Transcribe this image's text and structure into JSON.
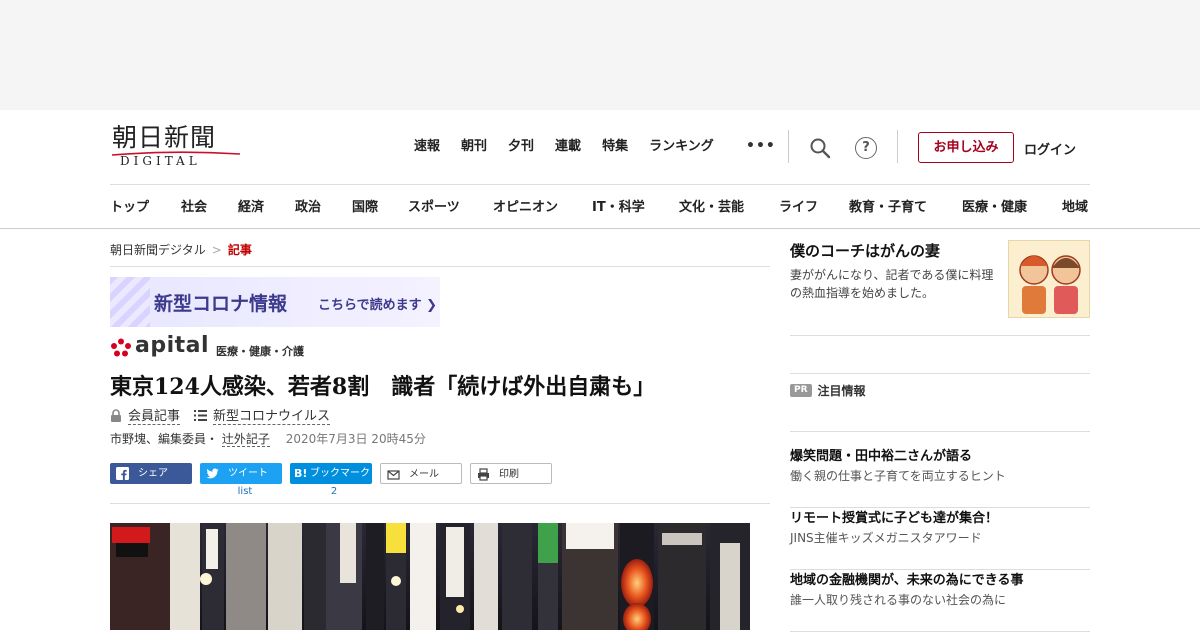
{
  "header": {
    "logo_main": "朝日新聞",
    "logo_sub": "DIGITAL",
    "top_nav": [
      "速報",
      "朝刊",
      "夕刊",
      "連載",
      "特集",
      "ランキング"
    ],
    "more": "•••",
    "help": "?",
    "apply_label": "お申し込み",
    "login_label": "ログイン",
    "categories": [
      "トップ",
      "社会",
      "経済",
      "政治",
      "国際",
      "スポーツ",
      "オピニオン",
      "IT・科学",
      "文化・芸能",
      "ライフ",
      "教育・子育て",
      "医療・健康",
      "地域"
    ]
  },
  "breadcrumb": {
    "home": "朝日新聞デジタル",
    "sep": ">",
    "current": "記事"
  },
  "banner": {
    "title": "新型コロナ情報",
    "link": "こちらで読めます ❯"
  },
  "apital": {
    "word": "apital",
    "category": "医療・健康・介護"
  },
  "article": {
    "headline": "東京124人感染、若者8割　識者「続けば外出自粛も」",
    "tag_member": "会員記事",
    "tag_topic": "新型コロナウイルス",
    "byline_prefix": "市野塊、編集委員・",
    "byline_author": "辻外記子",
    "date": "2020年7月3日 20時45分"
  },
  "share": {
    "facebook": "シェア",
    "twitter": "ツイート",
    "twitter_count": "list",
    "hatena": "ブックマーク",
    "hatena_badge": "B!",
    "hatena_count": "2",
    "mail": "メール",
    "print": "印刷"
  },
  "sidebar": {
    "coach_title": "僕のコーチはがんの妻",
    "coach_desc": "妻ががんになり、記者である僕に料理の熱血指導を始めました。",
    "pr_badge": "PR",
    "pr_label": "注目情報",
    "promos": [
      {
        "title": "爆笑問題・田中裕二さんが語る",
        "sub": "働く親の仕事と子育てを両立するヒント"
      },
      {
        "title": "リモート授賞式に子ども達が集合！",
        "sub": "JINS主催キッズメガニスタアワード"
      },
      {
        "title": "地域の金融機関が、未来の為にできる事",
        "sub": "誰一人取り残される事のない社会の為に"
      }
    ]
  },
  "colors": {
    "brand_red": "#a6001c",
    "facebook": "#3b5998",
    "twitter": "#1da1f2",
    "hatena": "#008fde",
    "apital_red": "#d7001e",
    "banner_text": "#3c3a8c"
  }
}
